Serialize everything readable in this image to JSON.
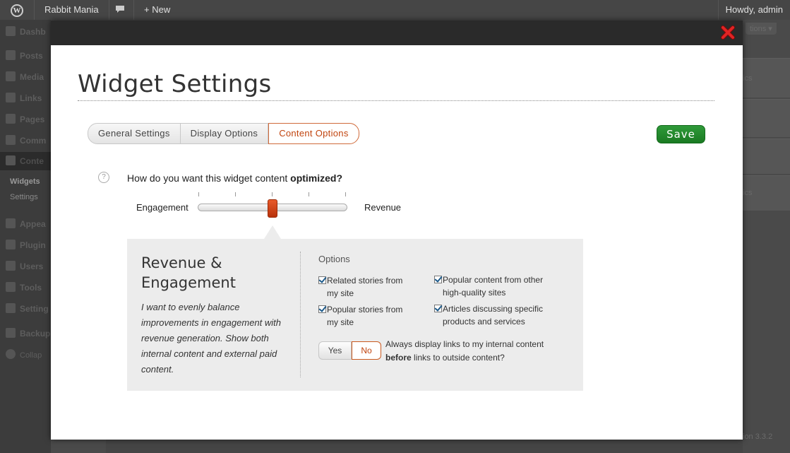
{
  "adminbar": {
    "logo_icon": "wordpress-logo-icon",
    "logo_glyph": "W",
    "site_name": "Rabbit Mania",
    "comments_icon": "speech-bubble-icon",
    "new_label": "+ New",
    "howdy": "Howdy, admin"
  },
  "sidebar": {
    "items": [
      "Dashb",
      "Posts",
      "Media",
      "Links",
      "Pages",
      "Comm",
      "Conte",
      "Appea",
      "Plugin",
      "Users",
      "Tools",
      "Setting",
      "Backup",
      "Collap"
    ],
    "sub_items": [
      "Widgets",
      "Settings"
    ]
  },
  "background": {
    "options_tab": "tions ▾",
    "right_text_1": "ics",
    "right_text_2": "ics",
    "version": "ion 3.3.2"
  },
  "modal": {
    "title": "Widget Settings",
    "close_icon": "close-x-icon",
    "tabs": [
      {
        "label": "General Settings",
        "active": false
      },
      {
        "label": "Display Options",
        "active": false
      },
      {
        "label": "Content Options",
        "active": true
      }
    ],
    "save_label": "Save",
    "help_icon_glyph": "?",
    "question_prefix": "How do you want this widget content ",
    "question_bold": "optimized?",
    "slider": {
      "left_label": "Engagement",
      "right_label": "Revenue",
      "ticks": 5,
      "value": 0.5
    },
    "panel": {
      "title_line1": "Revenue &",
      "title_line2": "Engagement",
      "description": "I want to evenly balance improvements in engagement with revenue generation. Show both internal content and external paid content.",
      "options_heading": "Options",
      "options": [
        {
          "line1": "Related stories from",
          "line2": "my site",
          "checked": true
        },
        {
          "line1": "Popular content from other",
          "line2": "high-quality sites",
          "checked": true
        },
        {
          "line1": "Popular stories from",
          "line2": "my site",
          "checked": true
        },
        {
          "line1": "Articles discussing specific",
          "line2": "products and services",
          "checked": true
        }
      ],
      "yes_label": "Yes",
      "no_label": "No",
      "selected": "No",
      "toggle_text_line1": "Always display links to my internal content",
      "toggle_text_bold": "before",
      "toggle_text_rest": " links to outside content?"
    }
  },
  "colors": {
    "accent": "#c1440e",
    "save_green": "#1f8a2a",
    "header_dark": "#2a2a2a"
  }
}
